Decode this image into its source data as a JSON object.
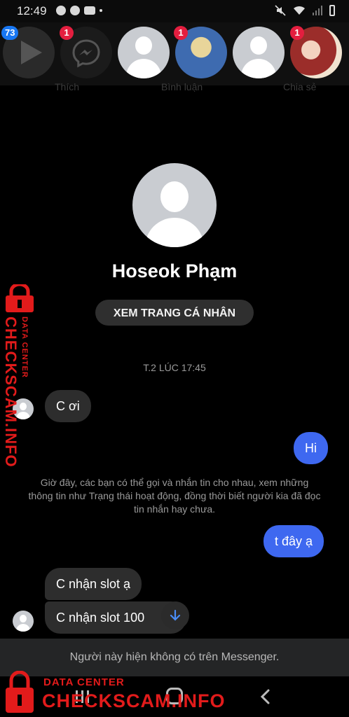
{
  "status_bar": {
    "time": "12:49"
  },
  "chat_heads": [
    {
      "type": "play",
      "badge": "73"
    },
    {
      "type": "messenger",
      "badge": "1"
    },
    {
      "type": "default-avatar",
      "badge": ""
    },
    {
      "type": "photo",
      "badge": "1"
    },
    {
      "type": "default-avatar",
      "badge": ""
    },
    {
      "type": "photo",
      "badge": "1"
    }
  ],
  "background_actions": [
    "Thích",
    "Bình luận",
    "Chia sẻ"
  ],
  "profile": {
    "name": "Hoseok Phạm",
    "view_profile_button": "XEM TRANG CÁ NHÂN"
  },
  "conversation": {
    "timestamp": "T.2 LÚC 17:45",
    "messages": [
      {
        "from": "them",
        "text": "C ơi"
      },
      {
        "from": "me",
        "text": "Hi"
      },
      {
        "from": "me",
        "text": "t đây ạ"
      },
      {
        "from": "them",
        "text": "C nhận slot ạ"
      },
      {
        "from": "them",
        "text": "C nhận slot 100"
      }
    ],
    "info_text": "Giờ đây, các bạn có thể gọi và nhắn tin cho nhau, xem những thông tin như Trạng thái hoạt động, đồng thời biết người kia đã đọc tin nhắn hay chưa."
  },
  "footer": {
    "text": "Người này hiện không có trên Messenger."
  },
  "watermark": {
    "label": "DATA CENTER",
    "site": "CHECKSCAM.INFO",
    "color": "#e21b1b"
  },
  "colors": {
    "outgoing_bubble": "#3e68f0",
    "incoming_bubble": "#2d2d2d",
    "badge_red": "#e41e3f",
    "badge_blue": "#1877f2"
  }
}
